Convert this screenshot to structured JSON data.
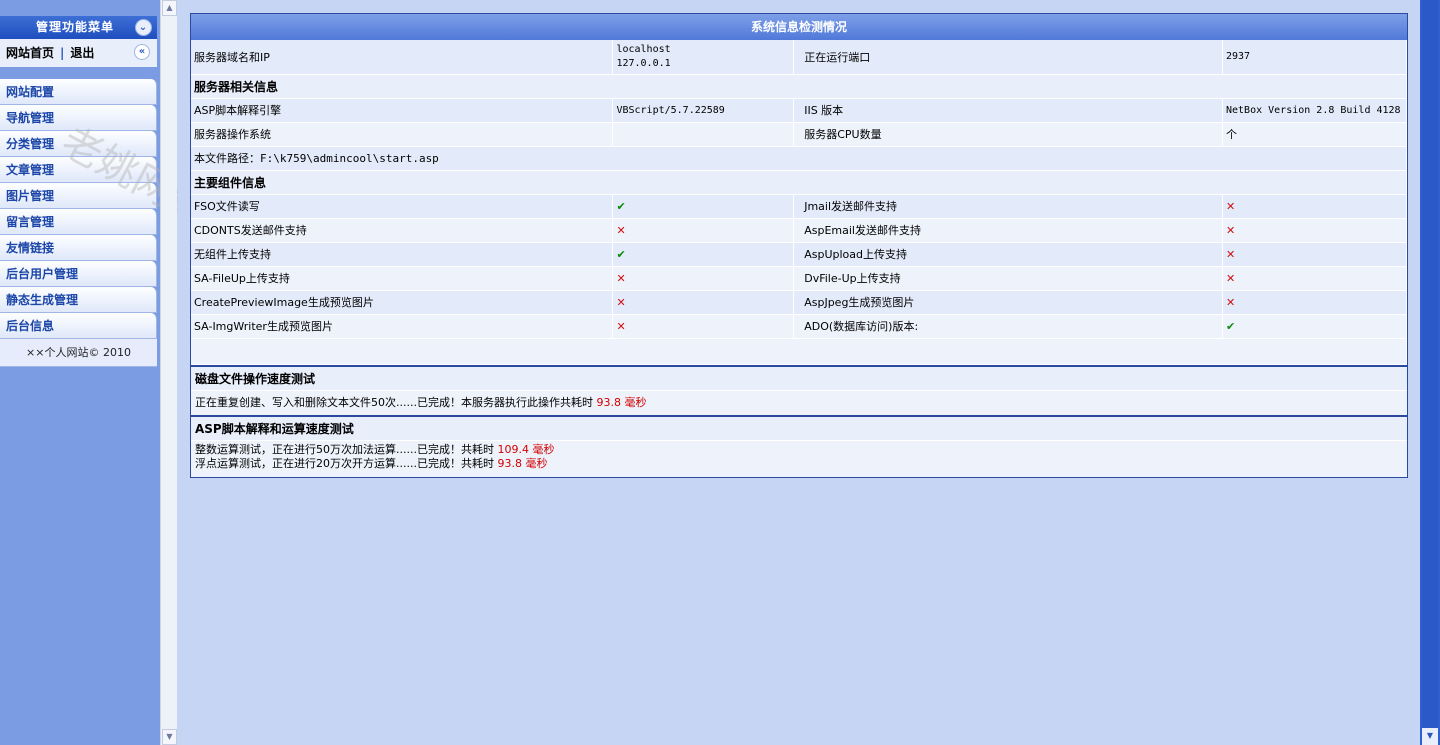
{
  "sidebar": {
    "header_title": "管理功能菜单",
    "header_toggle": "⌄",
    "link_home": "网站首页",
    "link_separator": "|",
    "link_logout": "退出",
    "collapse_icon": "«",
    "items": [
      {
        "label": "网站配置"
      },
      {
        "label": "导航管理"
      },
      {
        "label": "分类管理"
      },
      {
        "label": "文章管理"
      },
      {
        "label": "图片管理"
      },
      {
        "label": "留言管理"
      },
      {
        "label": "友情链接"
      },
      {
        "label": "后台用户管理"
      },
      {
        "label": "静态生成管理"
      },
      {
        "label": "后台信息"
      }
    ],
    "footer": "××个人网站© 2010",
    "watermark": "老姚网络"
  },
  "panel": {
    "title": "系统信息检测情况",
    "server": {
      "host_label": "服务器域名和IP",
      "host_name": "localhost",
      "host_ip": "127.0.0.1",
      "port_label": "正在运行端口",
      "port_value": "2937",
      "section_title": "服务器相关信息",
      "engine_label": "ASP脚本解释引擎",
      "engine_value": "VBScript/5.7.22589",
      "iis_label": "IIS 版本",
      "iis_value": "NetBox Version 2.8 Build 4128",
      "os_label": "服务器操作系统",
      "os_value": "",
      "cpu_label": "服务器CPU数量",
      "cpu_value": "个",
      "path_text": "本文件路径：F:\\k759\\admincool\\start.asp"
    },
    "components": {
      "section_title": "主要组件信息",
      "rows": [
        {
          "l_label": "FSO文件读写",
          "l_status": "✔",
          "l_ok": true,
          "r_label": "Jmail发送邮件支持",
          "r_status": "✕",
          "r_ok": false
        },
        {
          "l_label": "CDONTS发送邮件支持",
          "l_status": "✕",
          "l_ok": false,
          "r_label": "AspEmail发送邮件支持",
          "r_status": "✕",
          "r_ok": false
        },
        {
          "l_label": "无组件上传支持",
          "l_status": "✔",
          "l_ok": true,
          "r_label": "AspUpload上传支持",
          "r_status": "✕",
          "r_ok": false
        },
        {
          "l_label": "SA-FileUp上传支持",
          "l_status": "✕",
          "l_ok": false,
          "r_label": "DvFile-Up上传支持",
          "r_status": "✕",
          "r_ok": false
        },
        {
          "l_label": "CreatePreviewImage生成预览图片",
          "l_status": "✕",
          "l_ok": false,
          "r_label": "AspJpeg生成预览图片",
          "r_status": "✕",
          "r_ok": false
        },
        {
          "l_label": "SA-ImgWriter生成预览图片",
          "l_status": "✕",
          "l_ok": false,
          "r_label": "ADO(数据库访问)版本:",
          "r_status": "✔",
          "r_ok": true
        }
      ]
    },
    "disk_test": {
      "title": "磁盘文件操作速度测试",
      "text": "正在重复创建、写入和删除文本文件50次......已完成！本服务器执行此操作共耗时",
      "time": "93.8 毫秒"
    },
    "asp_test": {
      "title": "ASP脚本解释和运算速度测试",
      "int_text": "整数运算测试，正在进行50万次加法运算......已完成！共耗时",
      "int_time": "109.4 毫秒",
      "float_text": "浮点运算测试，正在进行20万次开方运算......已完成！共耗时",
      "float_time": "93.8 毫秒"
    }
  },
  "colors": {
    "accent": "#2a4aa0",
    "ok": "#0a8a0a",
    "fail": "#d21010"
  }
}
